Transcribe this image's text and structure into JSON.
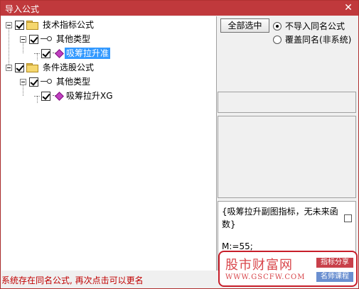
{
  "window": {
    "title": "导入公式",
    "close_glyph": "✕"
  },
  "tree": [
    {
      "label": "技术指标公式",
      "type": "folder",
      "checked": true,
      "expanded": true
    },
    {
      "label": "其他类型",
      "type": "group",
      "checked": true,
      "expanded": true
    },
    {
      "label": "吸筹拉升准",
      "type": "formula",
      "checked": true,
      "selected": true
    },
    {
      "label": "条件选股公式",
      "type": "folder",
      "checked": true,
      "expanded": true
    },
    {
      "label": "其他类型",
      "type": "group",
      "checked": true,
      "expanded": true
    },
    {
      "label": "吸筹拉升XG",
      "type": "formula",
      "checked": true,
      "selected": false
    }
  ],
  "controls": {
    "select_all_label": "全部选中",
    "radio_options": [
      {
        "label": "不导入同名公式",
        "selected": true
      },
      {
        "label": "覆盖同名(非系统)",
        "selected": false
      }
    ]
  },
  "description": {
    "text": "{吸筹拉升副图指标，无未来函数}",
    "code_line": "M:=55;"
  },
  "status": {
    "message": "系统存在同名公式, 再次点击可以更名"
  },
  "watermark": {
    "name": "股市财富网",
    "url": "WWW.GSCFW.COM",
    "tag1": "指标分享",
    "tag2": "名师课程"
  },
  "colors": {
    "title_bar": "#c0393c",
    "selection": "#3399ff",
    "status_text": "#c00000",
    "watermark_red": "#c81e2a"
  }
}
